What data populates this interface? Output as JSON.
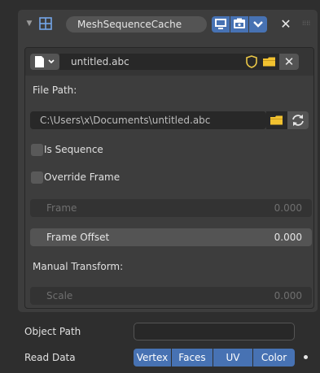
{
  "header": {
    "modifier_name": "MeshSequenceCache",
    "close_symbol": "✕",
    "icons": {
      "modifier_type": "mesh-cache-grid-icon",
      "collapse": "chevron-down-icon"
    }
  },
  "cache": {
    "file_name": "untitled.abc",
    "unlink_symbol": "✕",
    "file_path_label": "File Path:",
    "file_path_value": "C:\\Users\\x\\Documents\\untitled.abc",
    "is_sequence_label": "Is Sequence",
    "override_frame_label": "Override Frame",
    "frame_label": "Frame",
    "frame_value": "0.000",
    "frame_offset_label": "Frame Offset",
    "frame_offset_value": "0.000",
    "manual_transform_label": "Manual Transform:",
    "scale_label": "Scale",
    "scale_value": "0.000"
  },
  "object_path_label": "Object Path",
  "object_path_value": "",
  "read_data": {
    "label": "Read Data",
    "options": [
      "Vertex",
      "Faces",
      "UV",
      "Color"
    ]
  },
  "colors": {
    "accent": "#4772b3",
    "folder": "#f2c230",
    "shield": "#e8c547"
  }
}
